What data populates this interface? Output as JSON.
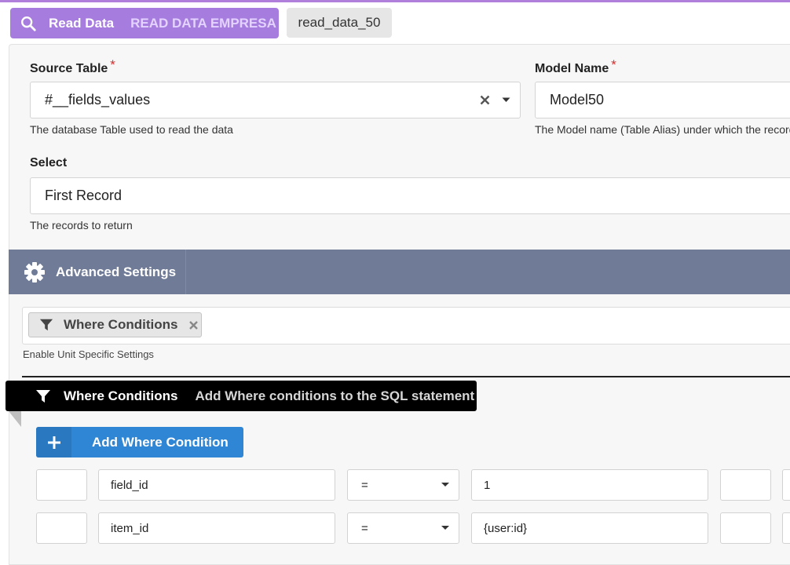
{
  "header": {
    "title": "Read Data",
    "subtitle": "READ DATA EMPRESA",
    "id_chip": "read_data_50",
    "accent": "#a67ddf"
  },
  "form": {
    "source_table": {
      "label": "Source Table",
      "required_mark": "*",
      "value": "#__fields_values",
      "help": "The database Table used to read the data"
    },
    "model_name": {
      "label": "Model Name",
      "required_mark": "*",
      "value": "Model50",
      "help": "The Model name (Table Alias) under which the records"
    },
    "select": {
      "label": "Select",
      "value": "First Record",
      "help": "The records to return"
    }
  },
  "advanced": {
    "label": "Advanced Settings",
    "tag": "Where Conditions",
    "help": "Enable Unit Specific Settings"
  },
  "where_section": {
    "title": "Where Conditions",
    "description": "Add Where conditions to the SQL statement",
    "add_button": "Add Where Condition",
    "add_button_color": "#2f86d4",
    "rows": [
      {
        "field": "field_id",
        "operator": "=",
        "value": "1"
      },
      {
        "field": "item_id",
        "operator": "=",
        "value": "{user:id}"
      }
    ]
  }
}
